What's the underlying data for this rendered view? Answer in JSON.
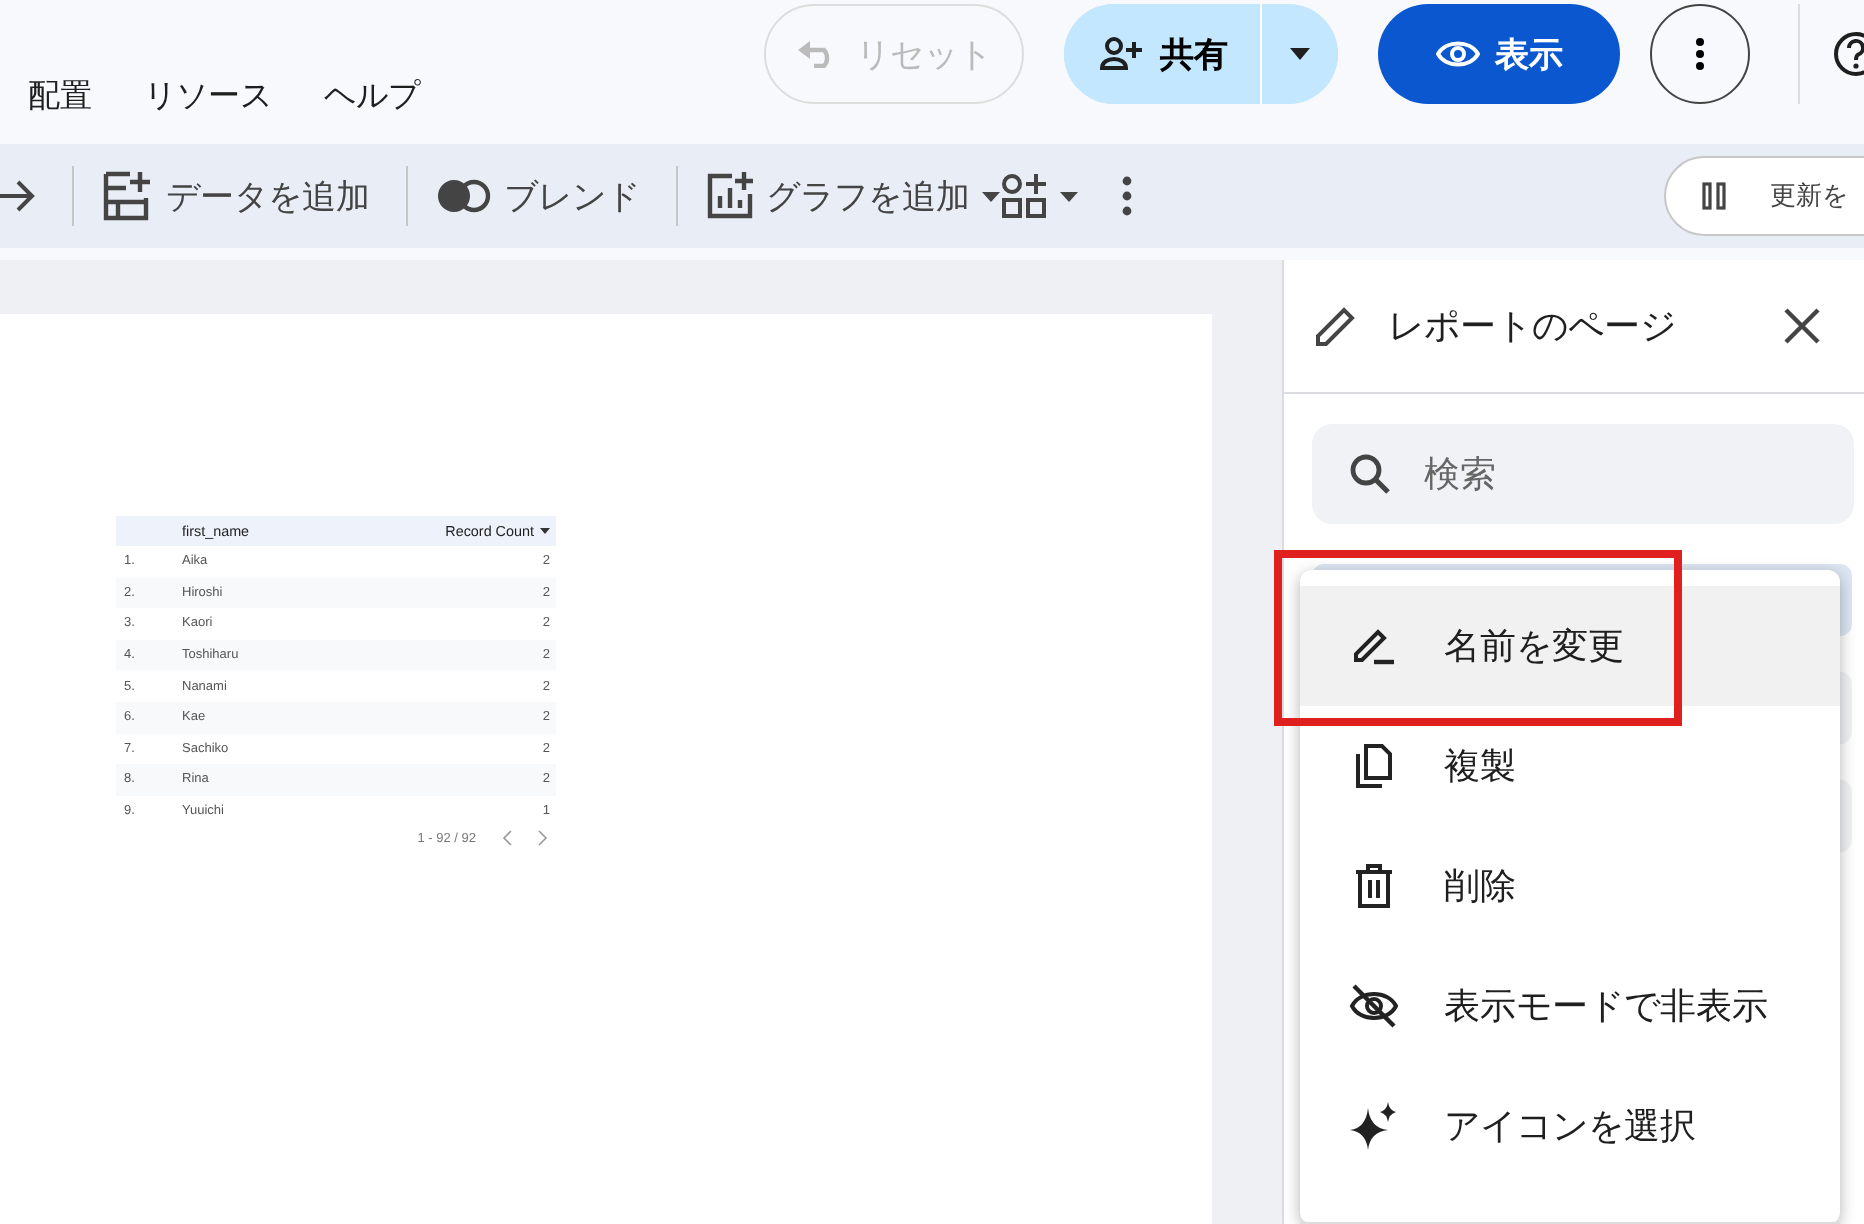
{
  "menu_bar": [
    {
      "label": "配置"
    },
    {
      "label": "リソース"
    },
    {
      "label": "ヘルプ"
    }
  ],
  "header_buttons": {
    "reset": {
      "label": "リセット",
      "disabled": true
    },
    "share": {
      "label": "共有"
    },
    "view": {
      "label": "表示"
    }
  },
  "toolbar": {
    "items": [
      {
        "kind": "add-data",
        "label": "データを追加"
      },
      {
        "kind": "blend",
        "label": "ブレンド"
      },
      {
        "kind": "add-chart",
        "label": "グラフを追加"
      }
    ],
    "refresh": {
      "label": "更新を"
    }
  },
  "table": {
    "columns": [
      "first_name",
      "Record Count"
    ],
    "rows": [
      {
        "index": "1.",
        "name": "Aika",
        "count": "2"
      },
      {
        "index": "2.",
        "name": "Hiroshi",
        "count": "2"
      },
      {
        "index": "3.",
        "name": "Kaori",
        "count": "2"
      },
      {
        "index": "4.",
        "name": "Toshiharu",
        "count": "2"
      },
      {
        "index": "5.",
        "name": "Nanami",
        "count": "2"
      },
      {
        "index": "6.",
        "name": "Kae",
        "count": "2"
      },
      {
        "index": "7.",
        "name": "Sachiko",
        "count": "2"
      },
      {
        "index": "8.",
        "name": "Rina",
        "count": "2"
      },
      {
        "index": "9.",
        "name": "Yuuichi",
        "count": "1"
      }
    ],
    "pagination": "1 - 92 / 92"
  },
  "panel": {
    "title": "レポートのページ",
    "search": {
      "placeholder": "検索"
    },
    "pages": [
      {
        "selected": true
      },
      {
        "selected": false
      },
      {
        "selected": false
      }
    ],
    "context_menu": [
      {
        "kind": "rename",
        "label": "名前を変更",
        "selected": true
      },
      {
        "kind": "duplicate",
        "label": "複製",
        "selected": false
      },
      {
        "kind": "delete",
        "label": "削除",
        "selected": false
      },
      {
        "kind": "hide",
        "label": "表示モードで非表示",
        "selected": false
      },
      {
        "kind": "icon",
        "label": "アイコンを選択",
        "selected": false
      }
    ]
  }
}
